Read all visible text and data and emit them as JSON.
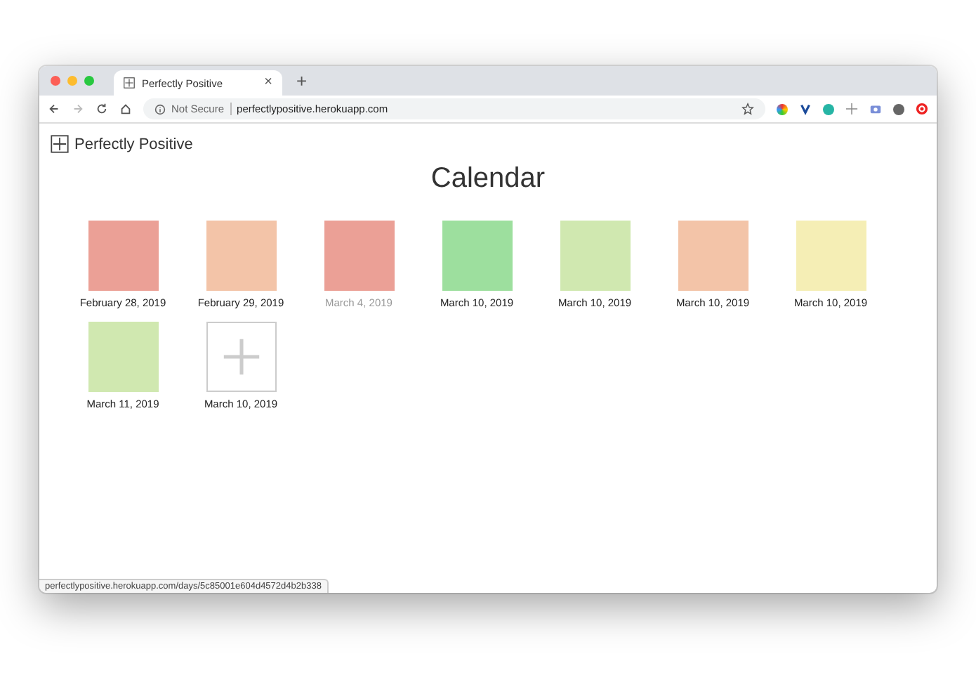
{
  "browser": {
    "tab_title": "Perfectly Positive",
    "tab_close": "×",
    "new_tab": "+",
    "security": "Not Secure",
    "url": "perfectlypositive.herokuapp.com",
    "status_url": "perfectlypositive.herokuapp.com/days/5c85001e604d4572d4b2b338"
  },
  "site": {
    "brand": "Perfectly Positive"
  },
  "page": {
    "title": "Calendar"
  },
  "days": [
    {
      "kind": "color",
      "color": "#eba096",
      "date": "February 28, 2019",
      "dimmed": false
    },
    {
      "kind": "color",
      "color": "#f3c4a8",
      "date": "February 29, 2019",
      "dimmed": false
    },
    {
      "kind": "color",
      "color": "#eba096",
      "date": "March 4, 2019",
      "dimmed": true
    },
    {
      "kind": "color",
      "color": "#9ddf9e",
      "date": "March 10, 2019",
      "dimmed": false
    },
    {
      "kind": "color",
      "color": "#d0e8b0",
      "date": "March 10, 2019",
      "dimmed": false
    },
    {
      "kind": "color",
      "color": "#f3c4a8",
      "date": "March 10, 2019",
      "dimmed": false
    },
    {
      "kind": "color",
      "color": "#f5eeb5",
      "date": "March 10, 2019",
      "dimmed": false
    },
    {
      "kind": "color",
      "color": "#d0e8b0",
      "date": "March 11, 2019",
      "dimmed": false
    },
    {
      "kind": "add",
      "date": "March 10, 2019",
      "dimmed": false
    }
  ]
}
